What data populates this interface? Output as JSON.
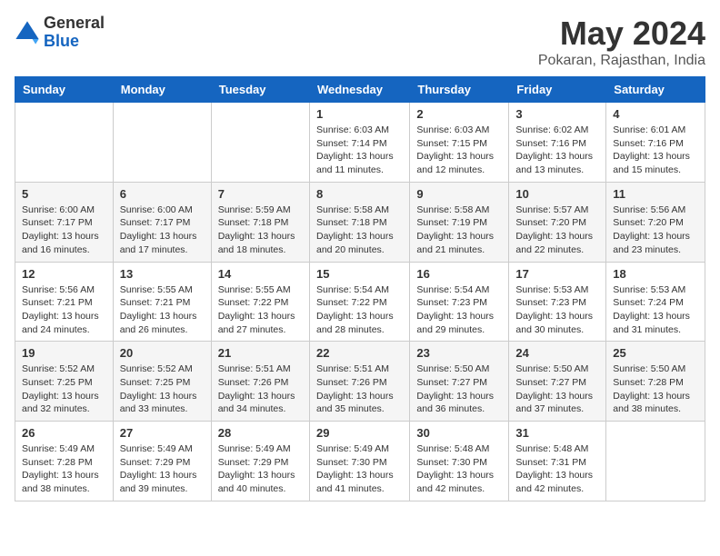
{
  "logo": {
    "general": "General",
    "blue": "Blue"
  },
  "title": {
    "month_year": "May 2024",
    "location": "Pokaran, Rajasthan, India"
  },
  "headers": [
    "Sunday",
    "Monday",
    "Tuesday",
    "Wednesday",
    "Thursday",
    "Friday",
    "Saturday"
  ],
  "weeks": [
    [
      {
        "day": "",
        "info": ""
      },
      {
        "day": "",
        "info": ""
      },
      {
        "day": "",
        "info": ""
      },
      {
        "day": "1",
        "info": "Sunrise: 6:03 AM\nSunset: 7:14 PM\nDaylight: 13 hours\nand 11 minutes."
      },
      {
        "day": "2",
        "info": "Sunrise: 6:03 AM\nSunset: 7:15 PM\nDaylight: 13 hours\nand 12 minutes."
      },
      {
        "day": "3",
        "info": "Sunrise: 6:02 AM\nSunset: 7:16 PM\nDaylight: 13 hours\nand 13 minutes."
      },
      {
        "day": "4",
        "info": "Sunrise: 6:01 AM\nSunset: 7:16 PM\nDaylight: 13 hours\nand 15 minutes."
      }
    ],
    [
      {
        "day": "5",
        "info": "Sunrise: 6:00 AM\nSunset: 7:17 PM\nDaylight: 13 hours\nand 16 minutes."
      },
      {
        "day": "6",
        "info": "Sunrise: 6:00 AM\nSunset: 7:17 PM\nDaylight: 13 hours\nand 17 minutes."
      },
      {
        "day": "7",
        "info": "Sunrise: 5:59 AM\nSunset: 7:18 PM\nDaylight: 13 hours\nand 18 minutes."
      },
      {
        "day": "8",
        "info": "Sunrise: 5:58 AM\nSunset: 7:18 PM\nDaylight: 13 hours\nand 20 minutes."
      },
      {
        "day": "9",
        "info": "Sunrise: 5:58 AM\nSunset: 7:19 PM\nDaylight: 13 hours\nand 21 minutes."
      },
      {
        "day": "10",
        "info": "Sunrise: 5:57 AM\nSunset: 7:20 PM\nDaylight: 13 hours\nand 22 minutes."
      },
      {
        "day": "11",
        "info": "Sunrise: 5:56 AM\nSunset: 7:20 PM\nDaylight: 13 hours\nand 23 minutes."
      }
    ],
    [
      {
        "day": "12",
        "info": "Sunrise: 5:56 AM\nSunset: 7:21 PM\nDaylight: 13 hours\nand 24 minutes."
      },
      {
        "day": "13",
        "info": "Sunrise: 5:55 AM\nSunset: 7:21 PM\nDaylight: 13 hours\nand 26 minutes."
      },
      {
        "day": "14",
        "info": "Sunrise: 5:55 AM\nSunset: 7:22 PM\nDaylight: 13 hours\nand 27 minutes."
      },
      {
        "day": "15",
        "info": "Sunrise: 5:54 AM\nSunset: 7:22 PM\nDaylight: 13 hours\nand 28 minutes."
      },
      {
        "day": "16",
        "info": "Sunrise: 5:54 AM\nSunset: 7:23 PM\nDaylight: 13 hours\nand 29 minutes."
      },
      {
        "day": "17",
        "info": "Sunrise: 5:53 AM\nSunset: 7:23 PM\nDaylight: 13 hours\nand 30 minutes."
      },
      {
        "day": "18",
        "info": "Sunrise: 5:53 AM\nSunset: 7:24 PM\nDaylight: 13 hours\nand 31 minutes."
      }
    ],
    [
      {
        "day": "19",
        "info": "Sunrise: 5:52 AM\nSunset: 7:25 PM\nDaylight: 13 hours\nand 32 minutes."
      },
      {
        "day": "20",
        "info": "Sunrise: 5:52 AM\nSunset: 7:25 PM\nDaylight: 13 hours\nand 33 minutes."
      },
      {
        "day": "21",
        "info": "Sunrise: 5:51 AM\nSunset: 7:26 PM\nDaylight: 13 hours\nand 34 minutes."
      },
      {
        "day": "22",
        "info": "Sunrise: 5:51 AM\nSunset: 7:26 PM\nDaylight: 13 hours\nand 35 minutes."
      },
      {
        "day": "23",
        "info": "Sunrise: 5:50 AM\nSunset: 7:27 PM\nDaylight: 13 hours\nand 36 minutes."
      },
      {
        "day": "24",
        "info": "Sunrise: 5:50 AM\nSunset: 7:27 PM\nDaylight: 13 hours\nand 37 minutes."
      },
      {
        "day": "25",
        "info": "Sunrise: 5:50 AM\nSunset: 7:28 PM\nDaylight: 13 hours\nand 38 minutes."
      }
    ],
    [
      {
        "day": "26",
        "info": "Sunrise: 5:49 AM\nSunset: 7:28 PM\nDaylight: 13 hours\nand 38 minutes."
      },
      {
        "day": "27",
        "info": "Sunrise: 5:49 AM\nSunset: 7:29 PM\nDaylight: 13 hours\nand 39 minutes."
      },
      {
        "day": "28",
        "info": "Sunrise: 5:49 AM\nSunset: 7:29 PM\nDaylight: 13 hours\nand 40 minutes."
      },
      {
        "day": "29",
        "info": "Sunrise: 5:49 AM\nSunset: 7:30 PM\nDaylight: 13 hours\nand 41 minutes."
      },
      {
        "day": "30",
        "info": "Sunrise: 5:48 AM\nSunset: 7:30 PM\nDaylight: 13 hours\nand 42 minutes."
      },
      {
        "day": "31",
        "info": "Sunrise: 5:48 AM\nSunset: 7:31 PM\nDaylight: 13 hours\nand 42 minutes."
      },
      {
        "day": "",
        "info": ""
      }
    ]
  ]
}
